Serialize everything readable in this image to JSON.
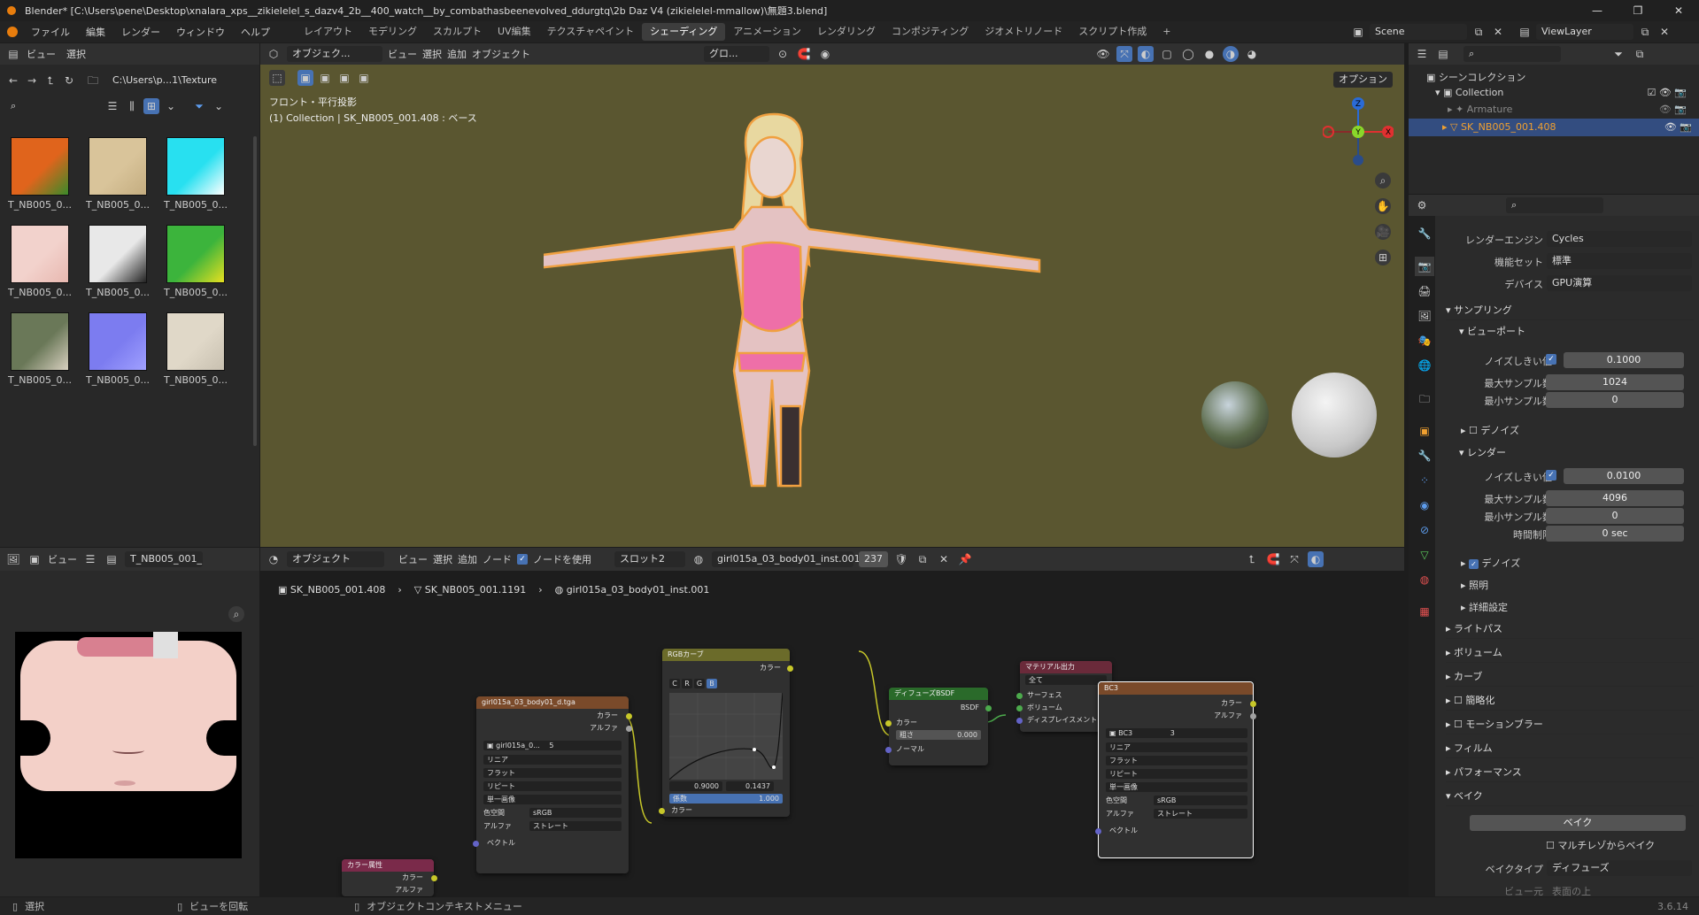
{
  "title": "Blender* [C:\\Users\\pene\\Desktop\\xnalara_xps__zikielelel_s_dazv4_2b__400_watch__by_combathasbeenevolved_ddurgtq\\2b Daz V4 (zikielelel-mmallow)\\無題3.blend]",
  "menu": [
    "ファイル",
    "編集",
    "レンダー",
    "ウィンドウ",
    "ヘルプ"
  ],
  "workspaces": [
    "レイアウト",
    "モデリング",
    "スカルプト",
    "UV編集",
    "テクスチャペイント",
    "シェーディング",
    "アニメーション",
    "レンダリング",
    "コンポジティング",
    "ジオメトリノード",
    "スクリプト作成"
  ],
  "scene": "Scene",
  "view_layer": "ViewLayer",
  "filebrowser": {
    "header": [
      "ビュー",
      "選択"
    ],
    "path": "C:\\Users\\p...1\\Texture\\",
    "items": [
      {
        "label": "T_NB005_0...",
        "color": "#e0641c",
        "color2": "#3a8a2a"
      },
      {
        "label": "T_NB005_0...",
        "color": "#d9c49a",
        "color2": "#c4ad80"
      },
      {
        "label": "T_NB005_0...",
        "color": "#28e0f0",
        "color2": "#ffffff"
      },
      {
        "label": "T_NB005_0...",
        "color": "#f2d2cc",
        "color2": "#e8b8b0"
      },
      {
        "label": "T_NB005_0...",
        "color": "#e8e8e8",
        "color2": "#222222"
      },
      {
        "label": "T_NB005_0...",
        "color": "#3cb43c",
        "color2": "#e8e020"
      },
      {
        "label": "T_NB005_0...",
        "color": "#6a7858",
        "color2": "#d8d0c0"
      },
      {
        "label": "T_NB005_0...",
        "color": "#7c7cf0",
        "color2": "#a0a0ff"
      },
      {
        "label": "T_NB005_0...",
        "color": "#e0d8c8",
        "color2": "#c8c0b0"
      }
    ]
  },
  "viewport": {
    "header": {
      "mode": "オブジェク...",
      "menus": [
        "ビュー",
        "選択",
        "追加",
        "オブジェクト"
      ],
      "transform": "グロ..."
    },
    "options": "オプション",
    "view_name": "フロント・平行投影",
    "collection_info": "(1) Collection | SK_NB005_001.408 : ベース",
    "axes": {
      "z": "Z",
      "y": "Y",
      "x": "X"
    }
  },
  "outliner": {
    "scene_collection": "シーンコレクション",
    "items": [
      {
        "label": "Collection"
      },
      {
        "label": "Armature"
      },
      {
        "label": "SK_NB005_001.408"
      }
    ]
  },
  "properties": {
    "render_engine_label": "レンダーエンジン",
    "render_engine": "Cycles",
    "feature_set_label": "機能セット",
    "feature_set": "標準",
    "device_label": "デバイス",
    "device": "GPU演算",
    "sampling": "サンプリング",
    "viewport": "ビューポート",
    "noise_threshold_label": "ノイズしきい値",
    "vp_noise": "0.1000",
    "max_samples_label": "最大サンプル数",
    "vp_max": "1024",
    "min_samples_label": "最小サンプル数",
    "vp_min": "0",
    "denoise": "デノイズ",
    "render": "レンダー",
    "r_noise": "0.0100",
    "r_max": "4096",
    "r_min": "0",
    "time_limit_label": "時間制限",
    "r_time": "0 sec",
    "lighting": "照明",
    "advanced": "詳細設定",
    "light_paths": "ライトパス",
    "volumes": "ボリューム",
    "curves": "カーブ",
    "simplify": "簡略化",
    "motion_blur": "モーションブラー",
    "film": "フィルム",
    "performance": "パフォーマンス",
    "bake": "ベイク",
    "bake_button": "ベイク",
    "multires": "マルチレゾからベイク",
    "bake_type_label": "ベイクタイプ",
    "bake_type": "ディフューズ",
    "view_from_label": "ビュー元",
    "view_from": "表面の上"
  },
  "image_editor": {
    "view": "ビュー",
    "image": "T_NB005_001_"
  },
  "node_editor": {
    "object": "オブジェクト",
    "menus": [
      "ビュー",
      "選択",
      "追加",
      "ノード"
    ],
    "use_nodes": "ノードを使用",
    "slot": "スロット2",
    "material": "girl015a_03_body01_inst.001",
    "users": "237",
    "breadcrumb": [
      "SK_NB005_001.408",
      "SK_NB005_001.1191",
      "girl015a_03_body01_inst.001"
    ]
  },
  "nodes": {
    "img": {
      "title": "girl015a_03_body01_d.tga",
      "color": "カラー",
      "alpha": "アルファ",
      "image": "girl015a_0...",
      "users": "5",
      "interp": "リニア",
      "proj": "フラット",
      "ext": "リピート",
      "src": "単一画像",
      "cs_label": "色空間",
      "cs": "sRGB",
      "alpha_label": "アルファ",
      "alpha_mode": "ストレート",
      "vector": "ベクトル"
    },
    "curve": {
      "title": "RGBカーブ",
      "out": "カラー",
      "channels": [
        "C",
        "R",
        "G",
        "B"
      ],
      "x": "0.9000",
      "y": "0.1437",
      "fac": "係数",
      "fac_val": "1.000",
      "in": "カラー"
    },
    "bsdf": {
      "title": "ディフューズBSDF",
      "out": "BSDF",
      "color": "カラー",
      "rough": "粗さ",
      "rough_val": "0.000",
      "normal": "ノーマル"
    },
    "out": {
      "title": "マテリアル出力",
      "target": "全て",
      "surface": "サーフェス",
      "volume": "ボリューム",
      "disp": "ディスプレイスメント"
    },
    "bc3": {
      "title": "BC3",
      "color": "カラー",
      "alpha": "アルファ",
      "image": "BC3",
      "users": "3",
      "interp": "リニア",
      "proj": "フラット",
      "ext": "リピート",
      "src": "単一画像",
      "cs_label": "色空間",
      "cs": "sRGB",
      "alpha_label": "アルファ",
      "alpha_mode": "ストレート",
      "vector": "ベクトル"
    },
    "attr": {
      "title": "カラー属性",
      "color": "カラー",
      "alpha": "アルファ"
    }
  },
  "status": {
    "select": "選択",
    "rotate": "ビューを回転",
    "context": "オブジェクトコンテキストメニュー",
    "version": "3.6.14"
  }
}
